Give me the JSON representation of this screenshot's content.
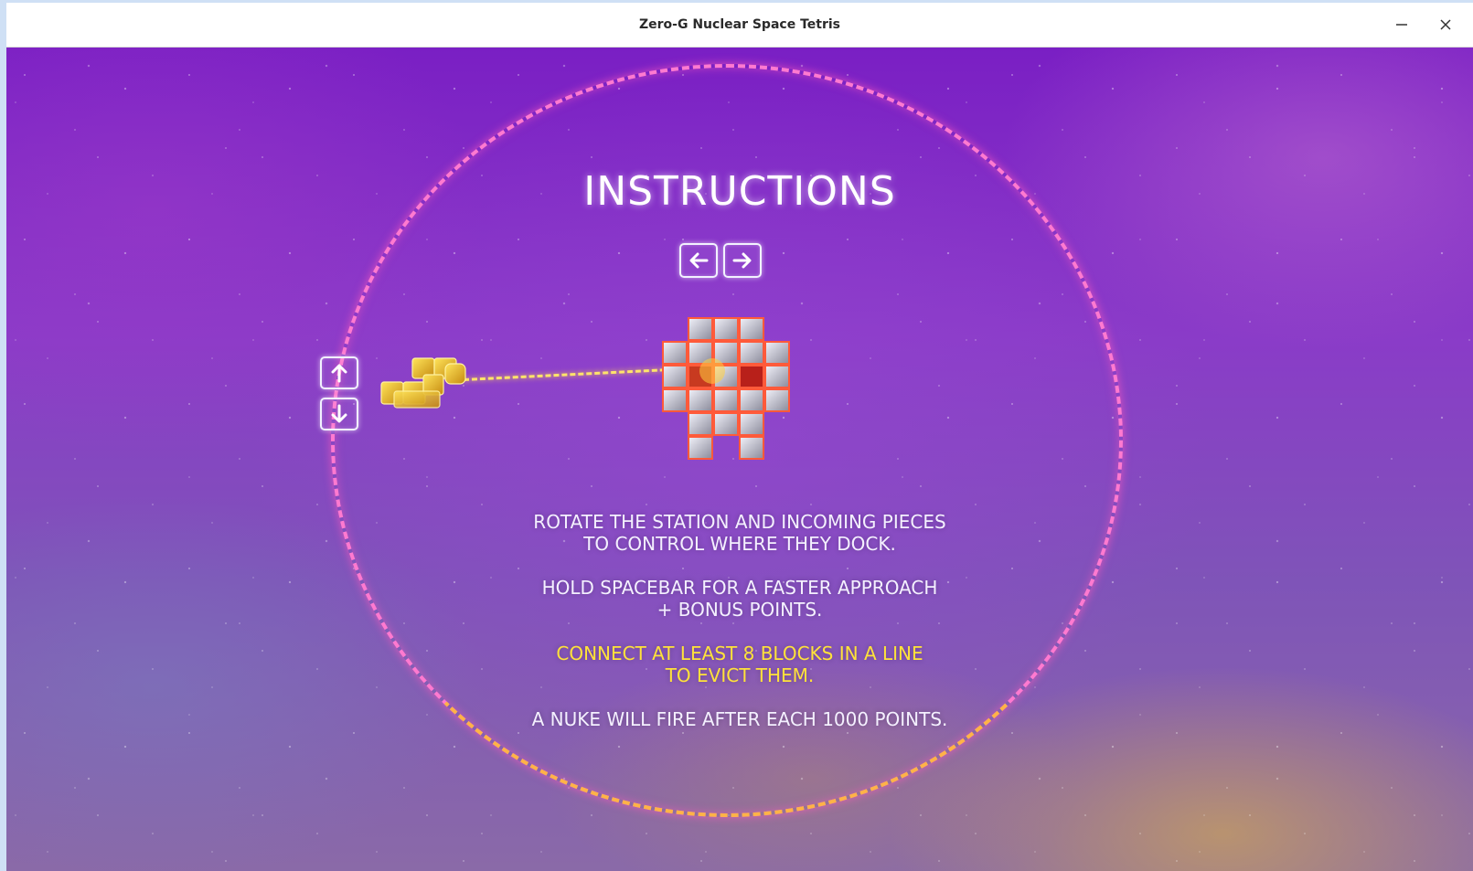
{
  "window": {
    "title": "Zero-G Nuclear Space Tetris",
    "minimize_icon": "minimize-icon",
    "close_icon": "close-icon"
  },
  "screen": {
    "heading": "INSTRUCTIONS",
    "keys": {
      "left": "arrow-left-key-icon",
      "right": "arrow-right-key-icon",
      "up": "arrow-up-key-icon",
      "down": "arrow-down-key-icon"
    },
    "instructions": [
      {
        "lines": [
          "ROTATE THE STATION AND INCOMING PIECES",
          "TO CONTROL WHERE THEY DOCK."
        ],
        "color": "#f4f0ff"
      },
      {
        "lines": [
          "HOLD SPACEBAR FOR A FASTER APPROACH",
          "+ BONUS POINTS."
        ],
        "color": "#f4f0ff"
      },
      {
        "lines": [
          "CONNECT AT LEAST 8 BLOCKS IN A LINE",
          "TO EVICT THEM."
        ],
        "color": "#ffe23a"
      },
      {
        "lines": [
          "A NUKE WILL FIRE AFTER EACH 1000 POINTS."
        ],
        "color": "#f4f0ff"
      }
    ]
  },
  "colors": {
    "ring": "#ff7ad0",
    "beam": "#ffe46a",
    "highlight": "#ffe23a"
  }
}
